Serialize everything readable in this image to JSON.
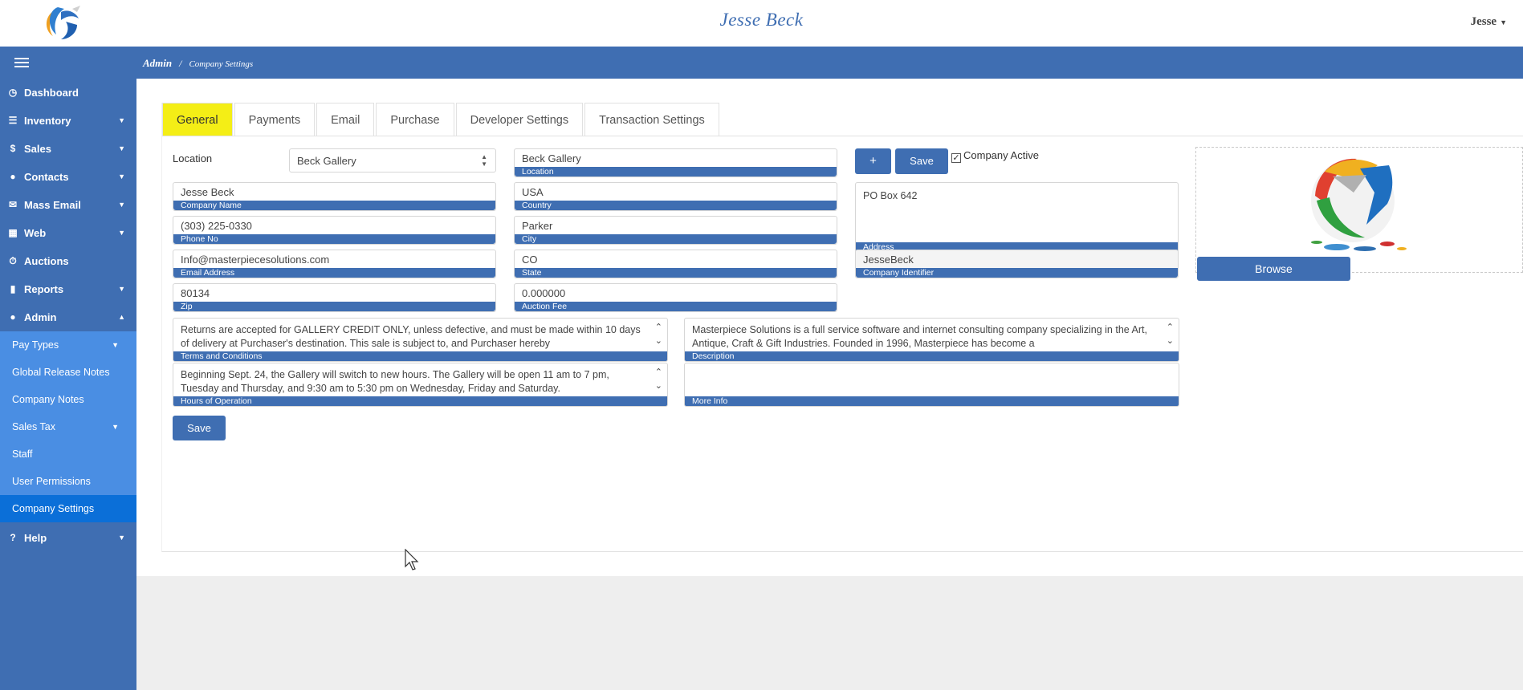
{
  "header": {
    "title": "Jesse Beck",
    "user": "Jesse"
  },
  "breadcrumb": {
    "root": "Admin",
    "separator": "/",
    "current": "Company Settings"
  },
  "sidebar": {
    "items": [
      {
        "label": "Dashboard",
        "icon": "clock-icon",
        "has_arrow": false
      },
      {
        "label": "Inventory",
        "icon": "list-icon",
        "has_arrow": true
      },
      {
        "label": "Sales",
        "icon": "dollar-icon",
        "has_arrow": true
      },
      {
        "label": "Contacts",
        "icon": "user-icon",
        "has_arrow": true
      },
      {
        "label": "Mass Email",
        "icon": "envelope-icon",
        "has_arrow": true
      },
      {
        "label": "Web",
        "icon": "table-icon",
        "has_arrow": true
      },
      {
        "label": "Auctions",
        "icon": "timer-icon",
        "has_arrow": false
      },
      {
        "label": "Reports",
        "icon": "clipboard-icon",
        "has_arrow": true
      },
      {
        "label": "Admin",
        "icon": "user-icon",
        "has_arrow": true
      }
    ],
    "admin_sub": [
      {
        "label": "Pay Types",
        "has_arrow": true
      },
      {
        "label": "Global Release Notes",
        "has_arrow": false
      },
      {
        "label": "Company Notes",
        "has_arrow": false
      },
      {
        "label": "Sales Tax",
        "has_arrow": true
      },
      {
        "label": "Staff",
        "has_arrow": false
      },
      {
        "label": "User Permissions",
        "has_arrow": false
      },
      {
        "label": "Company Settings",
        "has_arrow": false,
        "active": true
      }
    ],
    "help": {
      "label": "Help",
      "icon": "question-icon"
    }
  },
  "tabs": [
    "General",
    "Payments",
    "Email",
    "Purchase",
    "Developer Settings",
    "Transaction Settings"
  ],
  "form": {
    "location_label": "Location",
    "location_select": "Beck Gallery",
    "location_field": {
      "value": "Beck Gallery",
      "label": "Location"
    },
    "add_button": "+",
    "save_top": "Save",
    "company_active": {
      "label": "Company Active",
      "checked": true
    },
    "company_name": {
      "value": "Jesse Beck",
      "label": "Company Name"
    },
    "country": {
      "value": "USA",
      "label": "Country"
    },
    "address": {
      "value": "PO Box 642",
      "label": "Address"
    },
    "phone": {
      "value": "(303) 225-0330",
      "label": "Phone No"
    },
    "city": {
      "value": "Parker",
      "label": "City"
    },
    "email": {
      "value": "Info@masterpiecesolutions.com",
      "label": "Email Address"
    },
    "state": {
      "value": "CO",
      "label": "State"
    },
    "company_identifier": {
      "value": "JesseBeck",
      "label": "Company Identifier"
    },
    "zip": {
      "value": "80134",
      "label": "Zip"
    },
    "auction_fee": {
      "value": "0.000000",
      "label": "Auction Fee"
    },
    "terms": {
      "value": "Returns are accepted for GALLERY CREDIT ONLY, unless defective, and must be made within 10 days of delivery at Purchaser's destination. This sale is subject to, and Purchaser hereby",
      "label": "Terms and Conditions"
    },
    "description": {
      "value": "Masterpiece Solutions is a full service software and internet consulting company specializing in the Art, Antique, Craft & Gift Industries. Founded in 1996, Masterpiece has become a",
      "label": "Description"
    },
    "hours": {
      "value": "Beginning Sept. 24, the Gallery will switch to new hours. The Gallery will be open 11 am to 7 pm, Tuesday and Thursday, and 9:30 am to 5:30 pm on Wednesday, Friday and Saturday.",
      "label": "Hours of Operation"
    },
    "more_info": {
      "value": "",
      "label": "More Info"
    },
    "browse_button": "Browse",
    "save_bottom": "Save"
  },
  "colors": {
    "brand_blue": "#3f6eb2",
    "submenu_blue": "#4a8ee3",
    "active_blue": "#0b6fd8",
    "active_tab": "#f4ee16"
  }
}
